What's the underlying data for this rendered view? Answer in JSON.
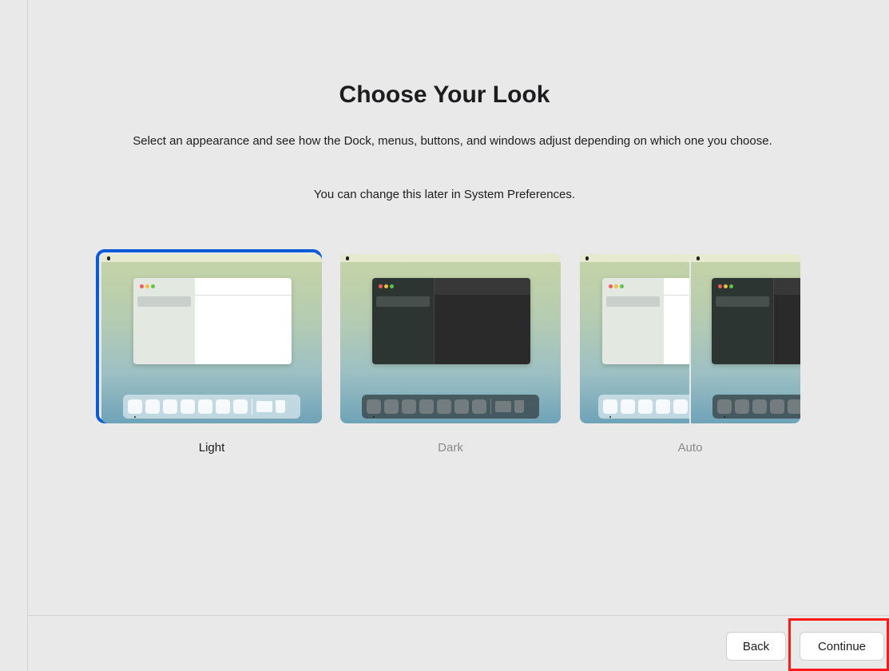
{
  "header": {
    "title": "Choose Your Look",
    "subtitle": "Select an appearance and see how the Dock, menus, buttons, and windows adjust depending on which one you choose.",
    "note": "You can change this later in System Preferences."
  },
  "appearances": [
    {
      "label": "Light",
      "selected": true
    },
    {
      "label": "Dark",
      "selected": false
    },
    {
      "label": "Auto",
      "selected": false
    }
  ],
  "footer": {
    "back_label": "Back",
    "continue_label": "Continue"
  },
  "colors": {
    "selection_ring": "#0a5bd8",
    "highlight_box": "#ff1a1a",
    "background": "#e9e9e9"
  },
  "icons": [
    "apple-logo-icon",
    "close-traffic-light",
    "minimize-traffic-light",
    "zoom-traffic-light",
    "dock-app-icon",
    "dock-folder-icon",
    "dock-trash-icon"
  ]
}
